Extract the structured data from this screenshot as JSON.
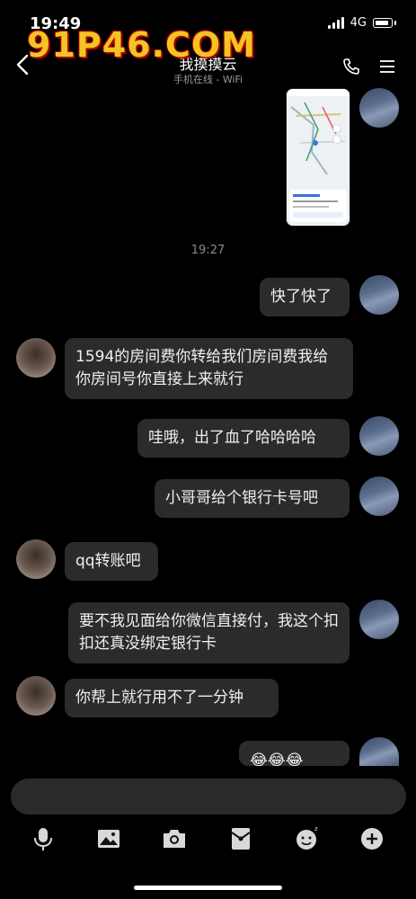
{
  "status": {
    "time": "19:49",
    "network": "4G"
  },
  "nav": {
    "title": "我摸摸云",
    "subtitle": "手机在线 - WiFi"
  },
  "watermark": {
    "text": "91P46.COM"
  },
  "chat": {
    "timestamp": "19:27",
    "messages": [
      {
        "from": "me",
        "text": "快了快了"
      },
      {
        "from": "other",
        "text": "1594的房间费你转给我们房间费我给你房间号你直接上来就行"
      },
      {
        "from": "me",
        "text": "哇哦，出了血了哈哈哈哈"
      },
      {
        "from": "me",
        "text": "小哥哥给个银行卡号吧"
      },
      {
        "from": "other",
        "text": "qq转账吧"
      },
      {
        "from": "me",
        "text": "要不我见面给你微信直接付，我这个扣扣还真没绑定银行卡"
      },
      {
        "from": "other",
        "text": "你帮上就行用不了一分钟"
      },
      {
        "from": "me",
        "text": "😂😂😂"
      }
    ]
  },
  "input": {
    "placeholder": ""
  },
  "toolbar": [
    "mic-icon",
    "image-icon",
    "camera-icon",
    "red-packet-icon",
    "emoji-icon",
    "plus-icon"
  ]
}
